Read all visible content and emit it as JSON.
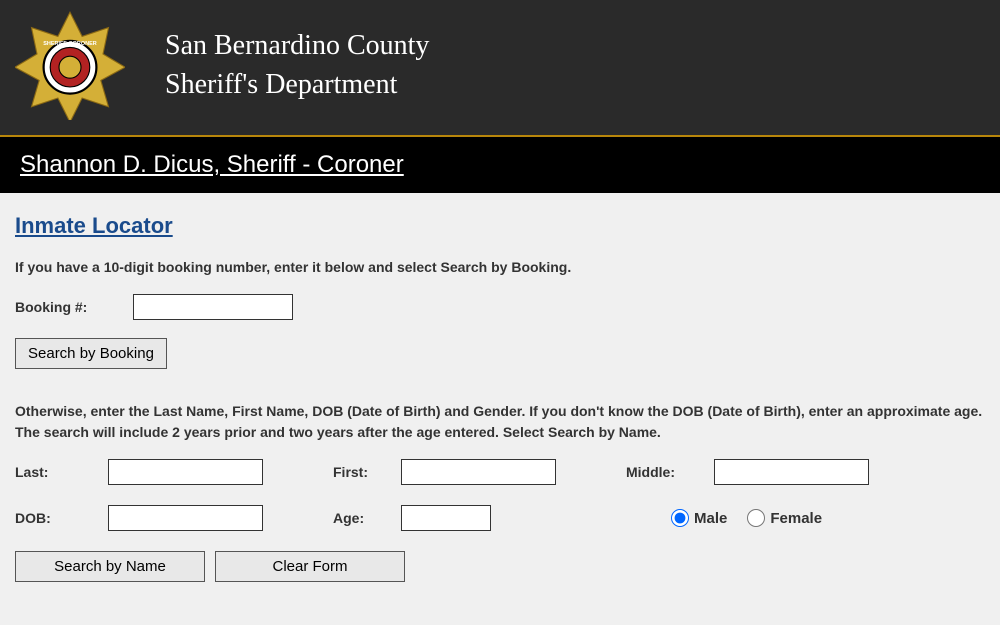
{
  "header": {
    "title_line1": "San Bernardino County",
    "title_line2": "Sheriff's Department"
  },
  "sheriff_bar": {
    "title": "Shannon D. Dicus, Sheriff - Coroner"
  },
  "page": {
    "title": "Inmate Locator",
    "booking_instruction": "If you have a 10-digit booking number, enter it below and select Search by Booking.",
    "name_instruction": "Otherwise, enter the Last Name, First Name, DOB (Date of Birth) and Gender.  If you don't know the DOB (Date of Birth), enter an approximate age.  The search will include 2 years prior and two years after the age entered.  Select Search by Name."
  },
  "form": {
    "booking_label": "Booking #:",
    "booking_value": "",
    "search_booking_button": "Search by Booking",
    "last_label": "Last:",
    "last_value": "",
    "first_label": "First:",
    "first_value": "",
    "middle_label": "Middle:",
    "middle_value": "",
    "dob_label": "DOB:",
    "dob_value": "",
    "age_label": "Age:",
    "age_value": "",
    "male_label": "Male",
    "female_label": "Female",
    "gender_selected": "male",
    "search_name_button": "Search by Name",
    "clear_button": "Clear Form"
  }
}
